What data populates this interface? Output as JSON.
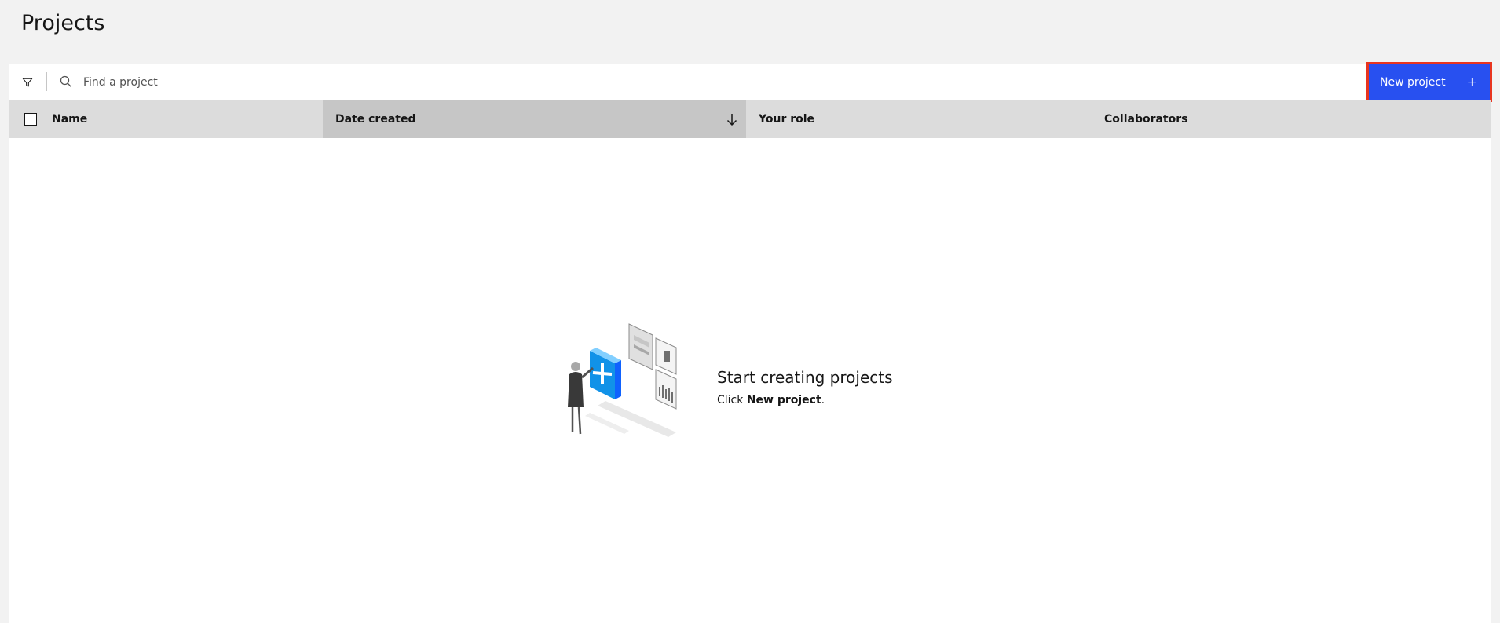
{
  "page": {
    "title": "Projects"
  },
  "toolbar": {
    "filter_icon": "filter-icon",
    "search_icon": "search-icon",
    "search_placeholder": "Find a project",
    "search_value": "",
    "new_project_label": "New project",
    "new_project_icon": "plus-icon",
    "accent_color": "#2850f0",
    "highlight_border_color": "#e8351f"
  },
  "table": {
    "columns": [
      {
        "label": "Name",
        "sorted": false
      },
      {
        "label": "Date created",
        "sorted": true,
        "sort_direction": "descending"
      },
      {
        "label": "Your role",
        "sorted": false
      },
      {
        "label": "Collaborators",
        "sorted": false
      }
    ],
    "rows": []
  },
  "empty_state": {
    "title": "Start creating projects",
    "subtitle_prefix": "Click ",
    "subtitle_bold": "New project",
    "subtitle_suffix": "."
  }
}
